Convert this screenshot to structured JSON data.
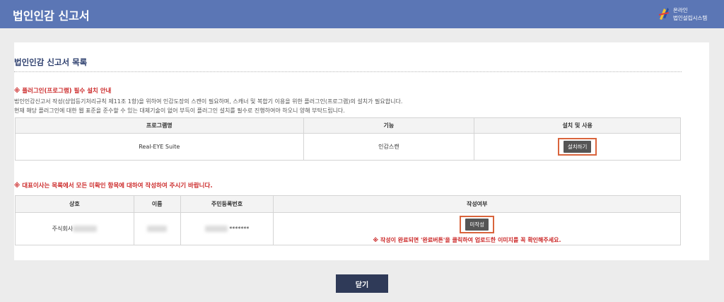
{
  "header": {
    "title": "법인인감 신고서",
    "logo_line1": "온라인",
    "logo_line2": "법인설립시스템"
  },
  "section": {
    "title": "법인인감 신고서 목록"
  },
  "plugin_notice": {
    "heading": "※ 플러그인(프로그램) 필수 설치 안내",
    "line1": "법인인감신고서 작성(상업등기처리규칙 제11조 1항)을 위하여 인감도장의 스캔이 필요하며, 스캐너 및 복합기 이용을 위한 플러그인(프로그램)의 설치가 필요합니다.",
    "line2": "현재 해당 플러그인에 대한 웹 표준을 준수할 수 있는 대체기술이 없어 부득이 플러그인 설치를 필수로 진행하여야 하오니 양해 부탁드립니다."
  },
  "plugin_table": {
    "headers": [
      "프로그램명",
      "기능",
      "설치 및 사용"
    ],
    "row": {
      "program": "Real-EYE Suite",
      "function": "인감스캔",
      "install_label": "설치하기"
    }
  },
  "rep_notice": "※ 대표이사는 목록에서 모든 미확인 항목에 대하여 작성하여 주시기 바랍니다.",
  "rep_table": {
    "headers": [
      "상호",
      "이름",
      "주민등록번호",
      "작성여부"
    ],
    "row": {
      "company_prefix": "주식회사",
      "rrn_mask": "*******",
      "status_label": "미작성",
      "note": "※ 작성이 완료되면 '완료버튼'을 클릭하여 업로드한 이미지를 꼭 확인해주세요."
    }
  },
  "close_label": "닫기"
}
